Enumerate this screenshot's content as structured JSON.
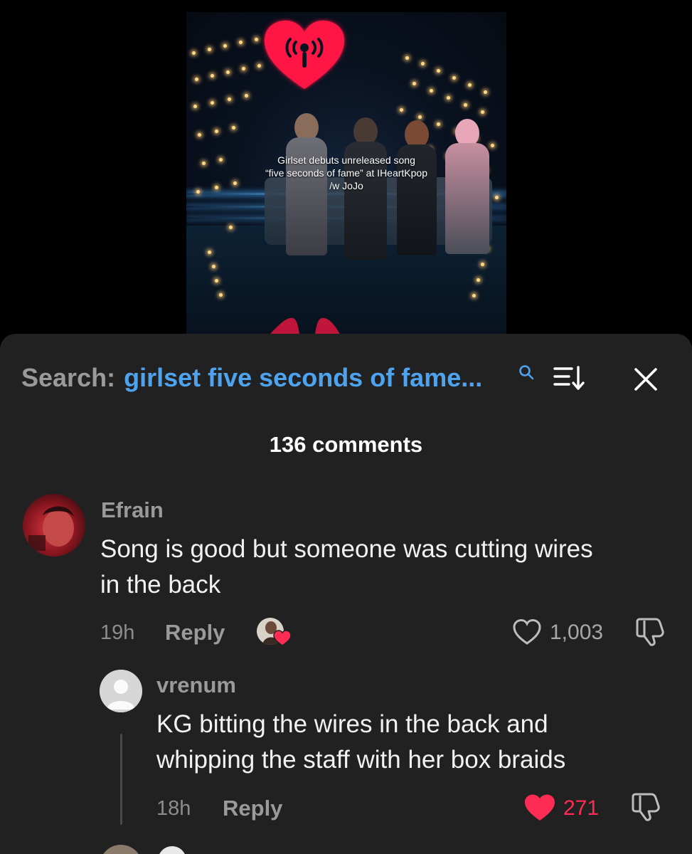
{
  "video": {
    "caption_line1": "Girlset debuts unreleased song",
    "caption_line2": "“five seconds of fame” at IHeartKpop",
    "caption_line3": "/w JoJo"
  },
  "search": {
    "label": "Search:",
    "query": "girlset five seconds of fame..."
  },
  "comments_header": {
    "count_label": "136 comments"
  },
  "comments": [
    {
      "username": "Efrain",
      "text_line1": "Song is good but someone was cutting wires",
      "text_line2": "in the back",
      "time": "19h",
      "reply_label": "Reply",
      "likes": "1,003",
      "liked": false,
      "creator_liked": true
    },
    {
      "username": "vrenum",
      "text_line1": "KG bitting the wires in the back and",
      "text_line2": "whipping the staff with her box braids",
      "time": "18h",
      "reply_label": "Reply",
      "likes": "271",
      "liked": true
    }
  ],
  "colors": {
    "sheet_bg": "#212121",
    "link_blue": "#4ea3ee",
    "like_red": "#fe2c55",
    "muted_text": "#9a9a9a"
  },
  "icons": {
    "search": "search-icon",
    "sort": "sort-icon",
    "close": "close-icon",
    "like": "heart-icon",
    "dislike": "thumbs-down-icon"
  }
}
